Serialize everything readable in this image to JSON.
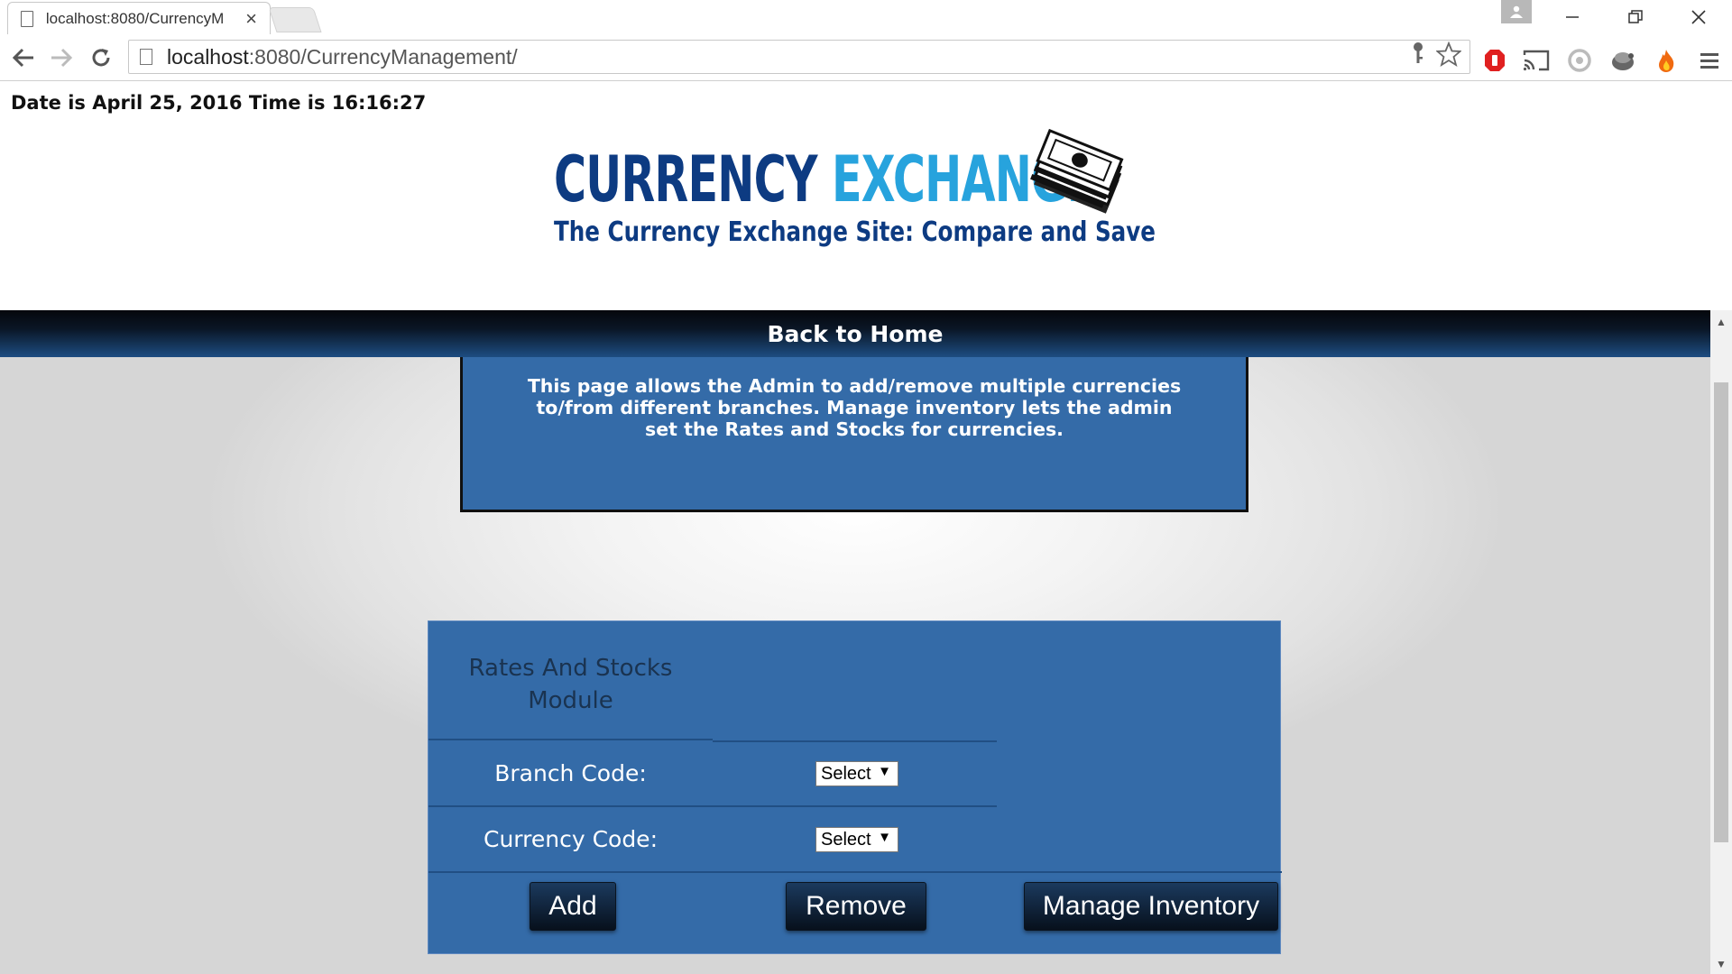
{
  "browser": {
    "tab_title": "localhost:8080/CurrencyM",
    "url_host": "localhost",
    "url_rest": ":8080/CurrencyManagement/"
  },
  "page": {
    "datetime": "Date is April 25, 2016 Time is 16:16:27",
    "logo": {
      "line1_a": "CURRENCY",
      "line1_b": "EXCHANGE",
      "tagline": "The Currency Exchange Site: Compare and Save"
    },
    "back_link": "Back to Home",
    "info_text": "This page allows the Admin to add/remove multiple currencies to/from different branches. Manage inventory lets the admin set the Rates and Stocks for currencies.",
    "module": {
      "title": "Rates And Stocks Module",
      "branch_label": "Branch Code:",
      "branch_value": "Select",
      "currency_label": "Currency Code:",
      "currency_value": "Select",
      "add_label": "Add",
      "remove_label": "Remove",
      "manage_label": "Manage Inventory"
    }
  },
  "colors": {
    "panel_blue": "#346ba8",
    "logo_navy": "#0d3b82",
    "logo_cyan": "#27a3dd"
  }
}
